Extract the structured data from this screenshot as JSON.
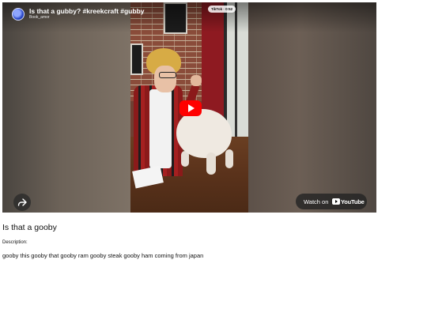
{
  "video": {
    "title": "Is that a gubby? #kreekcraft #gubby",
    "channel": "Book_amor",
    "overlay_badge": "TikTok  · 0:52",
    "watch_on_label": "Watch on",
    "watch_on_brand": "YouTube",
    "play_icon": "play-icon",
    "share_icon": "share-icon",
    "colors": {
      "play_button": "#ff0000",
      "overlay_pill": "#232323"
    }
  },
  "page": {
    "heading": "Is that a gooby",
    "description_label": "Description:",
    "description_text": "gooby this gooby that gooby ram gooby steak gooby ham coming from japan"
  }
}
